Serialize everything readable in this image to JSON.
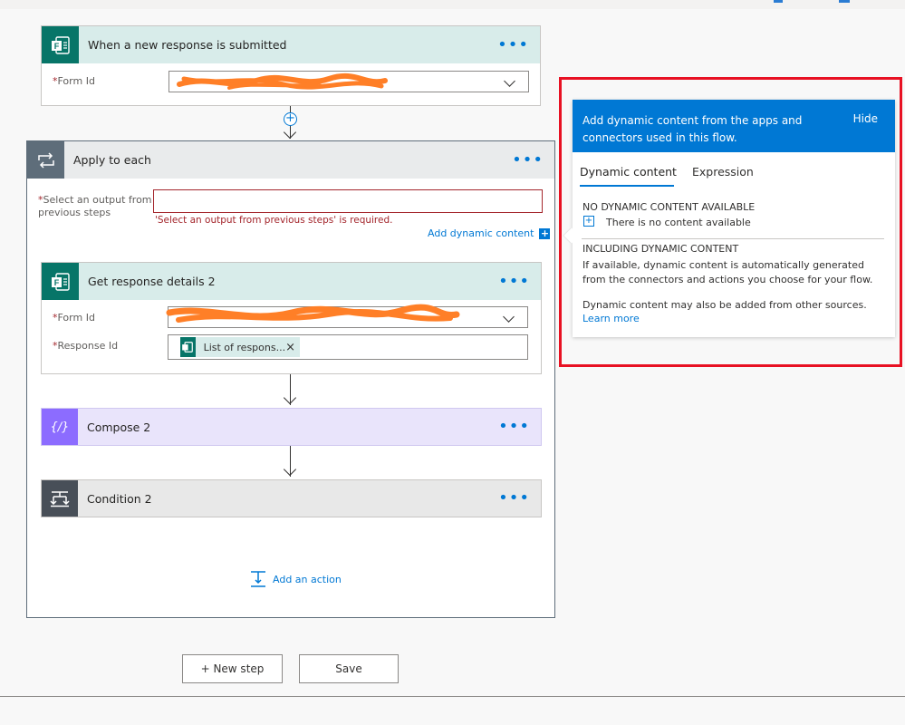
{
  "trigger": {
    "title": "When a new response is submitted",
    "more": "•••",
    "form_id_label": "Form Id",
    "required_mark": "*"
  },
  "connector": {
    "plus": "+"
  },
  "apply_each": {
    "title": "Apply to each",
    "more": "•••",
    "select_label_line1": "Select an output from",
    "select_label_line2": "previous steps",
    "required_mark": "*",
    "error": "'Select an output from previous steps' is required.",
    "add_dynamic": "Add dynamic content",
    "add_dynamic_icon": "+"
  },
  "get_response": {
    "title": "Get response details 2",
    "more": "•••",
    "form_id_label": "Form Id",
    "response_id_label": "Response Id",
    "required_mark": "*",
    "token_label": "List of respons...",
    "token_remove": "×"
  },
  "compose": {
    "title": "Compose 2",
    "icon_text": "{∕}",
    "more": "•••"
  },
  "condition": {
    "title": "Condition 2",
    "more": "•••"
  },
  "add_action": {
    "label": "Add an action"
  },
  "footer": {
    "new_step": "+ New step",
    "save": "Save"
  },
  "dynamic_panel": {
    "header": "Add dynamic content from the apps and connectors used in this flow.",
    "hide": "Hide",
    "tabs": [
      "Dynamic content",
      "Expression"
    ],
    "no_content_heading": "NO DYNAMIC CONTENT AVAILABLE",
    "no_content_text": "There is no content available",
    "including_heading": "INCLUDING DYNAMIC CONTENT",
    "including_text": "If available, dynamic content is automatically generated from the connectors and actions you choose for your flow.",
    "other_sources": "Dynamic content may also be added from other sources.",
    "learn_more": "Learn more"
  },
  "colors": {
    "forms_green": "#077568",
    "trigger_header_bg": "#d8ecea",
    "apply_header_bg": "#e9ebec",
    "apply_icon_bg": "#5e6d7a",
    "compose_bg": "#e9e4fb",
    "compose_icon_bg": "#8c6cff",
    "condition_bg": "#e8e8e8",
    "condition_icon_bg": "#484f58",
    "accent_blue": "#0078d4",
    "error_red": "#a4262c",
    "highlight_red": "#e81123",
    "scribble_orange": "#ff7f27"
  }
}
